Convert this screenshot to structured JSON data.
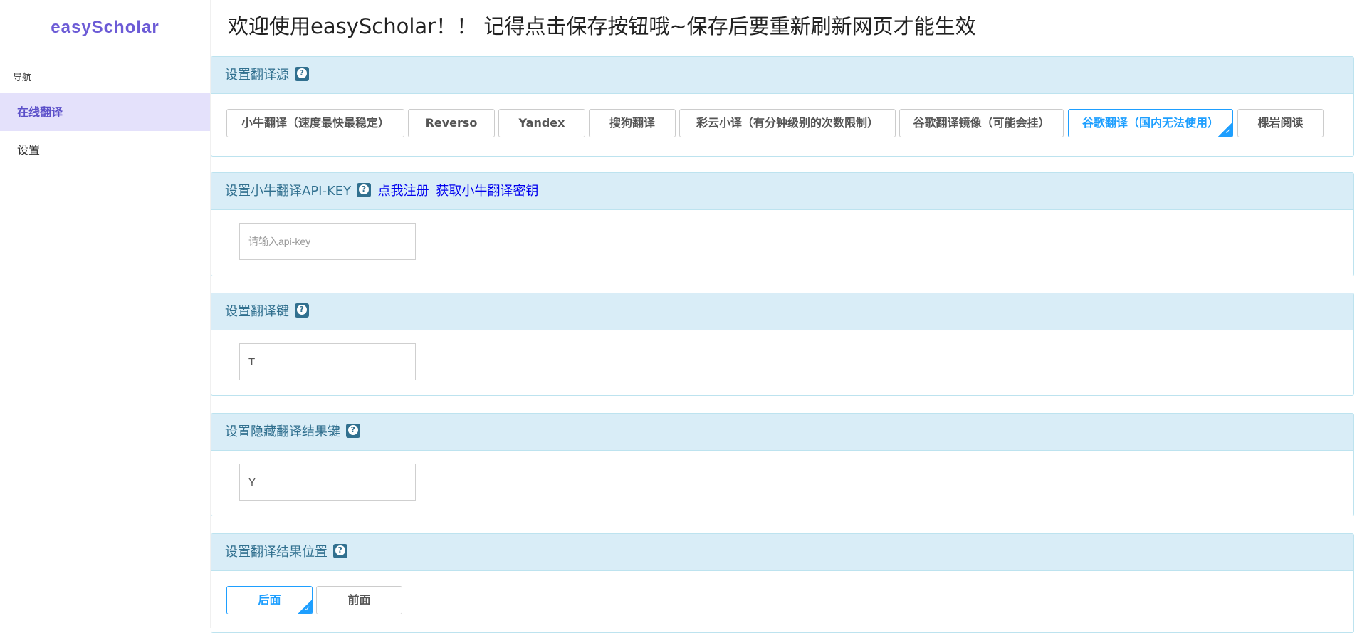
{
  "sidebar": {
    "brand": "easyScholar",
    "nav_title": "导航",
    "items": [
      {
        "label": "在线翻译",
        "active": true
      },
      {
        "label": "设置",
        "active": false
      }
    ]
  },
  "page_title": "欢迎使用easyScholar！！ 记得点击保存按钮哦~保存后要重新刷新网页才能生效",
  "sections": {
    "source": {
      "heading": "设置翻译源",
      "options": [
        "小牛翻译（速度最快最稳定）",
        "Reverso",
        "Yandex",
        "搜狗翻译",
        "彩云小译（有分钟级别的次数限制）",
        "谷歌翻译镜像（可能会挂）",
        "谷歌翻译（国内无法使用）",
        "棵岩阅读"
      ],
      "selected": "谷歌翻译（国内无法使用）"
    },
    "apikey": {
      "heading": "设置小牛翻译API-KEY",
      "link1": "点我注册",
      "link2": "获取小牛翻译密钥",
      "placeholder": "请输入api-key",
      "value": ""
    },
    "translate_key": {
      "heading": "设置翻译键",
      "value": "T"
    },
    "hide_key": {
      "heading": "设置隐藏翻译结果键",
      "value": "Y"
    },
    "position": {
      "heading": "设置翻译结果位置",
      "options": [
        "后面",
        "前面"
      ],
      "selected": "后面"
    }
  },
  "colors": {
    "brand": "#6c5bd6",
    "panel_head_bg": "#d9edf7",
    "panel_head_text": "#31708f",
    "selected": "#1e9fff"
  }
}
